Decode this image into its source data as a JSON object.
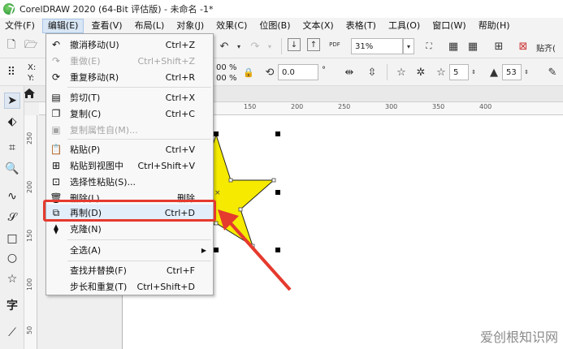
{
  "window": {
    "title": "CorelDRAW 2020 (64-Bit 评估版) - 未命名 -1*"
  },
  "menubar": [
    {
      "label": "文件(F)"
    },
    {
      "label": "编辑(E)",
      "active": true
    },
    {
      "label": "查看(V)"
    },
    {
      "label": "布局(L)"
    },
    {
      "label": "对象(J)"
    },
    {
      "label": "效果(C)"
    },
    {
      "label": "位图(B)"
    },
    {
      "label": "文本(X)"
    },
    {
      "label": "表格(T)"
    },
    {
      "label": "工具(O)"
    },
    {
      "label": "窗口(W)"
    },
    {
      "label": "帮助(H)"
    }
  ],
  "toolbar": {
    "zoom_value": "31%",
    "paste_label": "贴齐(",
    "pdf_label": "PDF",
    "x_label": "X:",
    "y_label": "Y:",
    "percent1": "%",
    "percent2": "%",
    "val_00": "00",
    "val_00b": "00",
    "rotation_value": "0.0",
    "rotation_unit": "°",
    "points_value": "5",
    "sharpness_value": "53"
  },
  "ruler": {
    "h_numbers": [
      "150",
      "200",
      "250",
      "300",
      "350",
      "400"
    ],
    "v_numbers": [
      "250",
      "200",
      "150",
      "100",
      "50"
    ]
  },
  "edit_menu": {
    "items": [
      {
        "icon": "undo-icon",
        "label": "撤消移动(U)",
        "shortcut": "Ctrl+Z",
        "disabled": false
      },
      {
        "icon": "redo-icon",
        "label": "重做(E)",
        "shortcut": "Ctrl+Shift+Z",
        "disabled": true
      },
      {
        "icon": "repeat-icon",
        "label": "重复移动(R)",
        "shortcut": "Ctrl+R",
        "disabled": false
      },
      {
        "icon": "cut-icon",
        "label": "剪切(T)",
        "shortcut": "Ctrl+X",
        "disabled": false
      },
      {
        "icon": "copy-icon",
        "label": "复制(C)",
        "shortcut": "Ctrl+C",
        "disabled": false
      },
      {
        "icon": "copy-props-icon",
        "label": "复制属性自(M)...",
        "shortcut": "",
        "disabled": true
      },
      {
        "icon": "paste-icon",
        "label": "粘贴(P)",
        "shortcut": "Ctrl+V",
        "disabled": false
      },
      {
        "icon": "paste-view-icon",
        "label": "粘贴到视图中",
        "shortcut": "Ctrl+Shift+V",
        "disabled": false
      },
      {
        "icon": "paste-special-icon",
        "label": "选择性粘贴(S)...",
        "shortcut": "",
        "disabled": false
      },
      {
        "icon": "delete-icon",
        "label": "删除(L)",
        "shortcut": "删除",
        "disabled": false
      },
      {
        "icon": "duplicate-icon",
        "label": "再制(D)",
        "shortcut": "Ctrl+D",
        "disabled": false
      },
      {
        "icon": "clone-icon",
        "label": "克隆(N)",
        "shortcut": "",
        "disabled": false
      },
      {
        "icon": "",
        "label": "全选(A)",
        "shortcut": "",
        "disabled": false,
        "submenu": true
      },
      {
        "icon": "",
        "label": "查找并替换(F)",
        "shortcut": "Ctrl+F",
        "disabled": false
      },
      {
        "icon": "",
        "label": "步长和重复(T)",
        "shortcut": "Ctrl+Shift+D",
        "disabled": false
      }
    ]
  },
  "colors": {
    "star_fill": "#f5ea00",
    "highlight_box": "#e53a2e",
    "arrow": "#e53a2e"
  },
  "watermark": "爱创根知识网"
}
